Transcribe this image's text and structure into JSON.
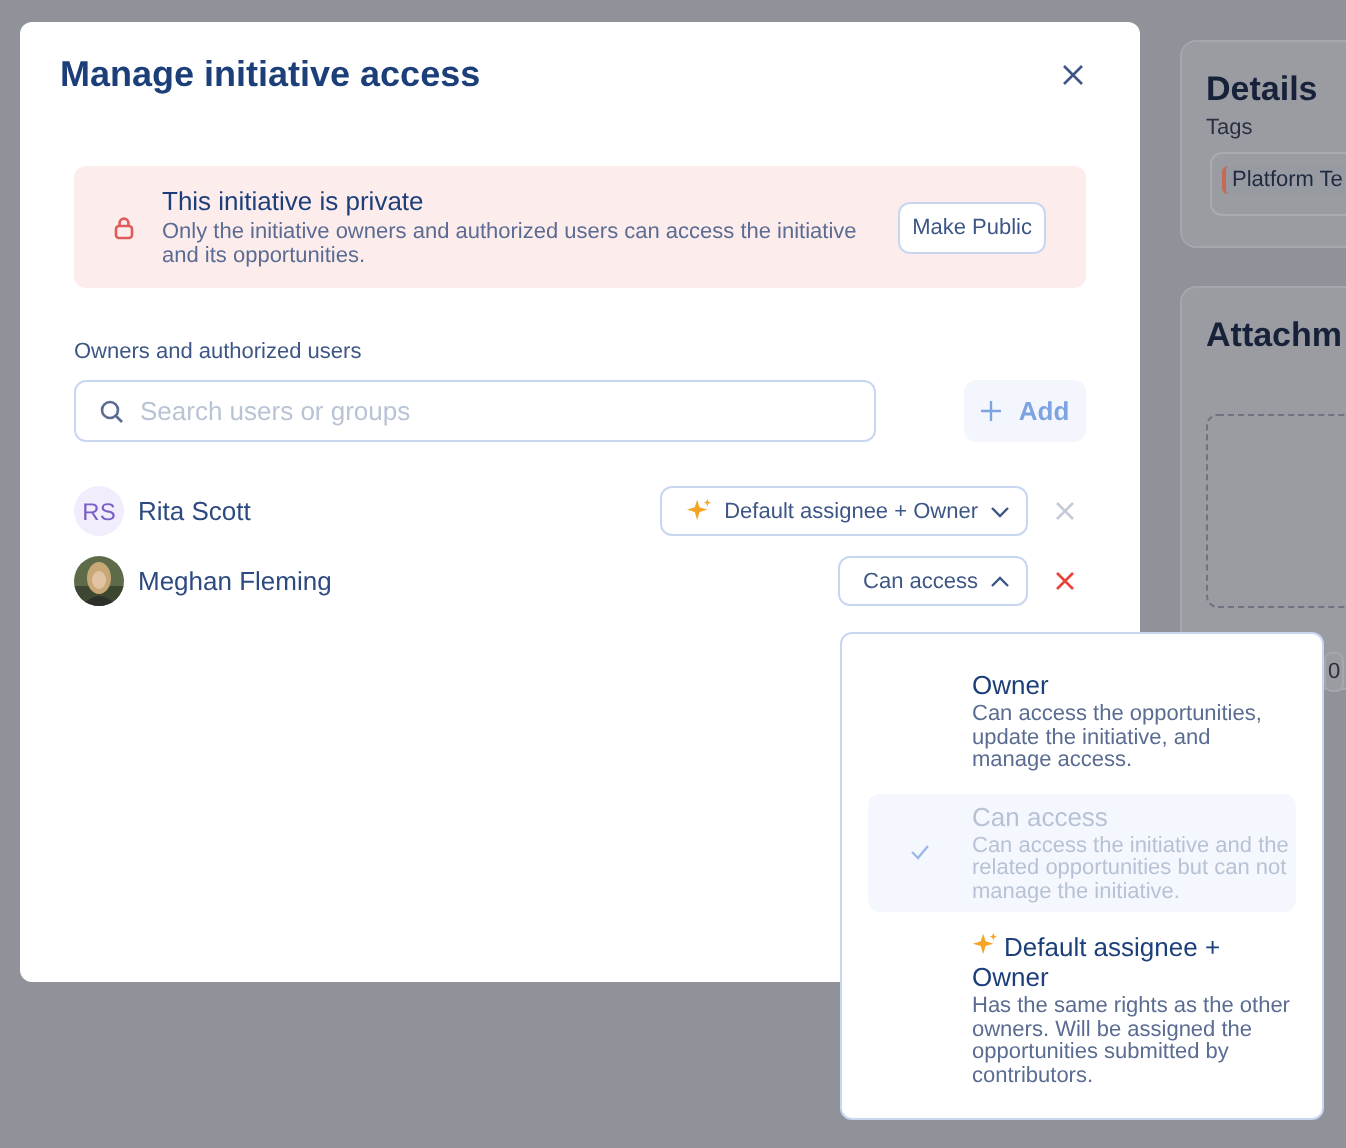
{
  "background": {
    "details_card": {
      "title": "Details",
      "tags_label": "Tags",
      "tags": [
        "Platform Te"
      ]
    },
    "attachments_card": {
      "title": "Attachm"
    },
    "fragment": "0"
  },
  "dialog": {
    "title": "Manage initiative access",
    "notice": {
      "title": "This initiative is private",
      "text": "Only the initiative owners and authorized users can access the initiative and its opportunities.",
      "button": "Make Public"
    },
    "users_label": "Owners and authorized users",
    "search": {
      "placeholder": "Search users or groups"
    },
    "add_button": {
      "label": "Add",
      "disabled": true
    },
    "users": [
      {
        "name": "Rita Scott",
        "initials": "RS",
        "role": "Default assignee + Owner",
        "role_sparkle": true,
        "menu_open": false,
        "remove_hovered": false
      },
      {
        "name": "Meghan Fleming",
        "role": "Can access",
        "role_sparkle": false,
        "menu_open": true,
        "remove_hovered": true
      }
    ]
  },
  "role_menu": [
    {
      "kind": "plain",
      "title": "Owner",
      "description": "Can access the opportunities, update the initiative, and manage access.",
      "selected": false
    },
    {
      "kind": "plain",
      "title": "Can access",
      "description": "Can access the initiative and the related opportunities but can not manage the initiative.",
      "selected": true
    },
    {
      "kind": "sparkle",
      "title": "Default assignee + Owner",
      "description": "Has the same rights as the other owners. Will be assigned the opportunities submitted by contributors.",
      "selected": false
    }
  ]
}
